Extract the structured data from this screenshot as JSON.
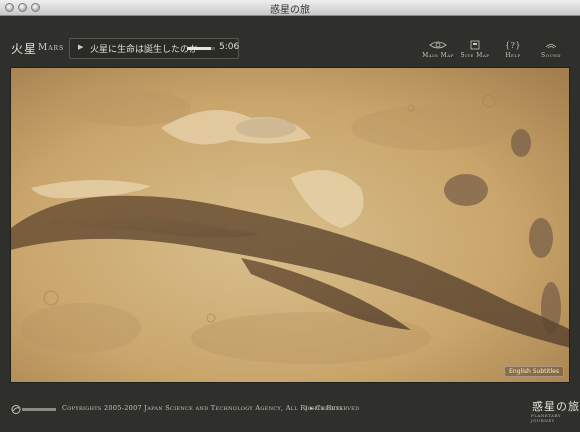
{
  "window": {
    "title": "惑星の旅"
  },
  "header": {
    "planet_jp": "火星",
    "planet_en": "Mars",
    "chapter": {
      "title": "火星に生命は誕生したのか",
      "progress": 0.85,
      "time": "5:06"
    }
  },
  "nav": [
    {
      "id": "main-map",
      "label": "Main Map",
      "icon": "eye-icon"
    },
    {
      "id": "site-map",
      "label": "Site Map",
      "icon": "sitemap-icon"
    },
    {
      "id": "help",
      "label": "Help",
      "icon": "help-icon"
    },
    {
      "id": "sound",
      "label": "Sound",
      "icon": "sound-icon"
    }
  ],
  "viewer": {
    "subtitle_button": "English Subtitles"
  },
  "footer": {
    "copyright": "Copyrights 2005-2007 Japan Science and Technology Agency, All Rights Reserved",
    "credits": "Credits",
    "brand_jp": "惑星の旅",
    "brand_en": "PLANETARY JOURNEY"
  },
  "colors": {
    "background": "#2f302b",
    "mars_light": "#dcc08a",
    "mars_dark": "#8b6a3f"
  }
}
